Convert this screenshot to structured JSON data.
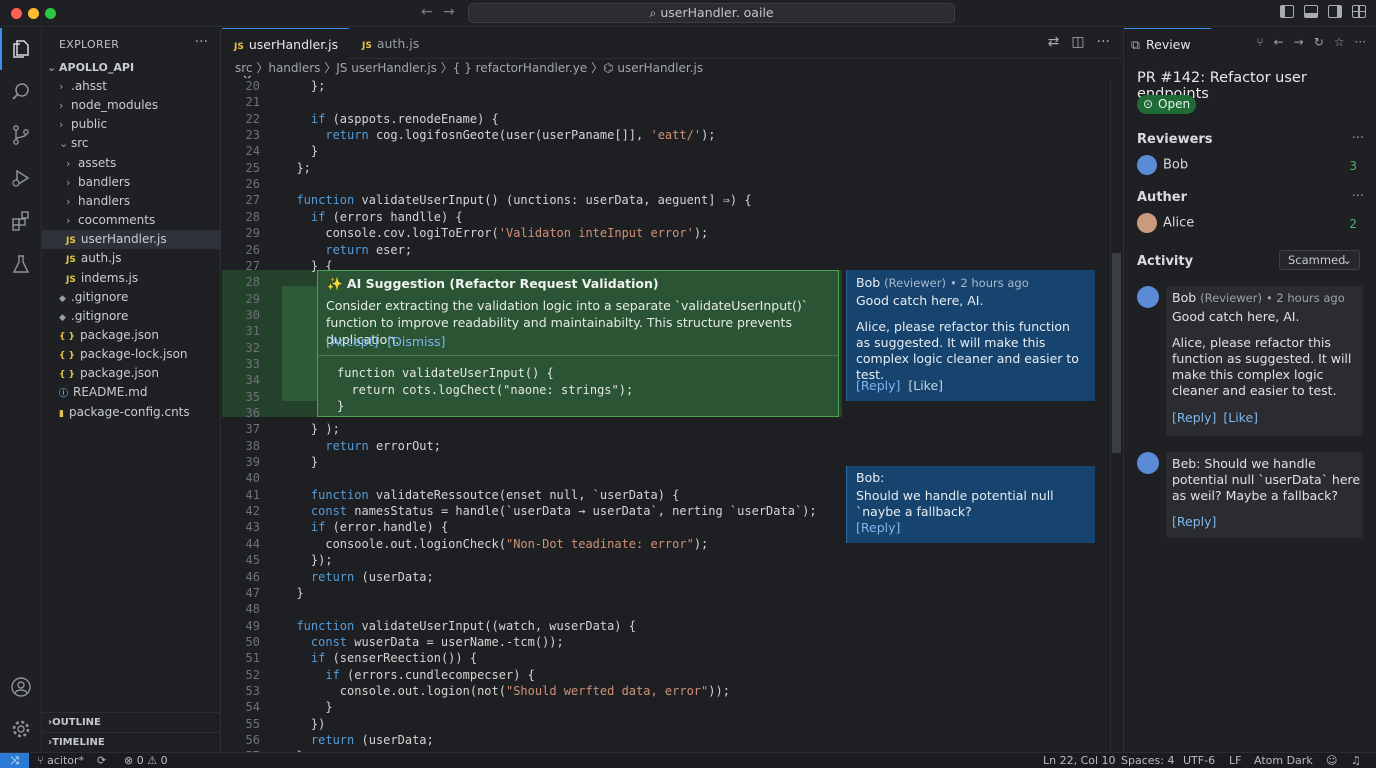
{
  "window": {
    "search_text": "userHandler. oaile"
  },
  "explorer": {
    "title": "EXPLORER",
    "more": "···",
    "root": "APOLLO_API",
    "items": [
      {
        "label": ".ahsst",
        "kind": "folder",
        "depth": 1
      },
      {
        "label": "node_modules",
        "kind": "folder",
        "depth": 1
      },
      {
        "label": "public",
        "kind": "folder",
        "depth": 1
      },
      {
        "label": "src",
        "kind": "folder-open",
        "depth": 1
      },
      {
        "label": "assets",
        "kind": "folder",
        "depth": 2
      },
      {
        "label": "bandlers",
        "kind": "folder",
        "depth": 2
      },
      {
        "label": "handlers",
        "kind": "folder",
        "depth": 2
      },
      {
        "label": "cocomments",
        "kind": "folder",
        "depth": 2
      },
      {
        "label": "userHandler.js",
        "kind": "js",
        "depth": 2
      },
      {
        "label": "auth.js",
        "kind": "js",
        "depth": 2
      },
      {
        "label": "indems.js",
        "kind": "js",
        "depth": 2
      },
      {
        "label": ".gitignore",
        "kind": "git",
        "depth": 1
      },
      {
        "label": ".gitignore",
        "kind": "git",
        "depth": 1
      },
      {
        "label": "package.json",
        "kind": "json",
        "depth": 1
      },
      {
        "label": "package-lock.json",
        "kind": "json",
        "depth": 1
      },
      {
        "label": "package.json",
        "kind": "json",
        "depth": 1
      },
      {
        "label": "README.md",
        "kind": "md",
        "depth": 1
      },
      {
        "label": "package-config.cnts",
        "kind": "lock",
        "depth": 1
      }
    ],
    "outline": "OUTLINE",
    "timeline": "TIMELINE"
  },
  "tabs": [
    {
      "label": "userHandler.js",
      "badge": "JS",
      "close": "×"
    },
    {
      "label": "auth.js",
      "badge": "JS"
    }
  ],
  "breadcrumb": "src 〉handlers 〉JS userHandler.js 〉{ } refactorHandler.ye 〉⌬ userHandler.js",
  "code_lines": [
    {
      "n": "20",
      "t": "    };"
    },
    {
      "n": "21",
      "t": ""
    },
    {
      "n": "22",
      "t": "    if (asppots.renodeEname) {"
    },
    {
      "n": "23",
      "t": "      return cog.logifosnGeote(user(userPaname[]], 'eatt/');"
    },
    {
      "n": "24",
      "t": "    }"
    },
    {
      "n": "25",
      "t": "  };"
    },
    {
      "n": "26",
      "t": ""
    },
    {
      "n": "27",
      "t": "  function validateUserInput() (unctions: userData, aeguent] ⇒) {"
    },
    {
      "n": "28",
      "t": "    if (errors handlle) {"
    },
    {
      "n": "29",
      "t": "      console.cov.logiToError('Validaton inteInput error');"
    },
    {
      "n": "26",
      "t": "      return eser;"
    },
    {
      "n": "27",
      "t": "    } {"
    },
    {
      "n": "28",
      "t": ""
    },
    {
      "n": "29",
      "t": ""
    },
    {
      "n": "30",
      "t": ""
    },
    {
      "n": "31",
      "t": ""
    },
    {
      "n": "32",
      "t": ""
    },
    {
      "n": "33",
      "t": ""
    },
    {
      "n": "34",
      "t": ""
    },
    {
      "n": "35",
      "t": ""
    },
    {
      "n": "36",
      "t": ""
    },
    {
      "n": "37",
      "t": "    } );"
    },
    {
      "n": "38",
      "t": "      return errorOut;"
    },
    {
      "n": "39",
      "t": "    }"
    },
    {
      "n": "40",
      "t": ""
    },
    {
      "n": "41",
      "t": "    function validateRessoutce(enset null, `userData) {"
    },
    {
      "n": "42",
      "t": "    const namesStatus = handle(`userData → userData`, nerting `userData`);"
    },
    {
      "n": "43",
      "t": "    if (error.handle) {"
    },
    {
      "n": "44",
      "t": "      consoole.out.logionCheck(\"Non-Dot teadinate: error\");"
    },
    {
      "n": "45",
      "t": "    });"
    },
    {
      "n": "46",
      "t": "    return (userData;"
    },
    {
      "n": "47",
      "t": "  }"
    },
    {
      "n": "48",
      "t": ""
    },
    {
      "n": "49",
      "t": "  function validateUserInput((ⱳatch, ⱳuserData) {"
    },
    {
      "n": "50",
      "t": "    const ⱳuserData = userName.-tcm());"
    },
    {
      "n": "51",
      "t": "    if (senserReection()) {"
    },
    {
      "n": "52",
      "t": "      if (errors.cundlecompecser) {"
    },
    {
      "n": "53",
      "t": "        console.out.logion(not(\"Should werfted data, error\"));"
    },
    {
      "n": "54",
      "t": "      }"
    },
    {
      "n": "55",
      "t": "    })"
    },
    {
      "n": "56",
      "t": "    return (userData;"
    },
    {
      "n": "57",
      "t": "  }"
    }
  ],
  "ai_suggestion": {
    "title": "✨ AI Suggestion (Refactor Request Validation)",
    "body": "Consider extracting the validation logic into a separate `validateUserInput()` function to improve readability and maintainabilty. This structure prevents duplication.",
    "accept": "[Accept]",
    "dismiss": "[Dismiss]",
    "code": "function validateUserInput() {\n  return cots.logChect(\"naone: strings\");\n}"
  },
  "inline_comments": [
    {
      "author": "Bob",
      "role": "(Reviewer)",
      "time": "• 2 hours ago",
      "text1": "Good catch here, AI.",
      "text2": "Alice, please refactor this function as suggested. It will make this complex logic cleaner and easier to test.",
      "reply": "[Reply]",
      "like": "[Like]"
    },
    {
      "author": "Bob:",
      "text1": "Should we handle potential null `naybe a fallback?",
      "reply": "[Reply]"
    }
  ],
  "review": {
    "tab": "Review",
    "pr_title": "PR #142: Refactor user endpoints",
    "status": "Open",
    "reviewers_heading": "Reviewers",
    "reviewer": {
      "name": "Bob",
      "count": "3"
    },
    "author_heading": "Auther",
    "author": {
      "name": "Alice",
      "count": "2"
    },
    "activity_heading": "Activity",
    "filter": "Scammed",
    "activity": [
      {
        "author": "Bob",
        "role": "(Reviewer)",
        "time": "• 2 hours ago",
        "text1": "Good catch here, AI.",
        "text2": "Alice, please refactor this function as suggested. It will make this complex logic cleaner and easier to test.",
        "reply": "[Reply]",
        "like": "[Like]"
      },
      {
        "author": "Beb",
        "text1": ": Should we handle potential null `userData` here as weil? Maybe a fallback?",
        "reply": "[Reply]"
      }
    ]
  },
  "status": {
    "branch": "acitor*",
    "problems": "⊗ 0 ⚠ 0",
    "cursor": "Ln 22, Col 10",
    "spaces": "Spaces: 4",
    "encoding": "UTF-6",
    "eol": "LF",
    "theme": "Atom  Dark"
  },
  "colors": {
    "accent": "#3d8ee8",
    "suggestion_bg": "#2b5434",
    "comment_bg": "#16446e",
    "open_badge": "#1e6b35"
  }
}
